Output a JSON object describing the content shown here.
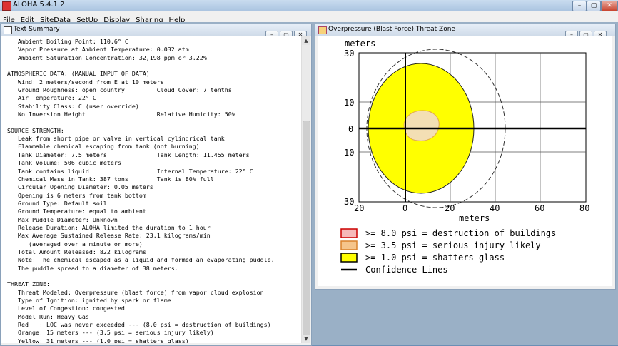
{
  "app": {
    "title": "ALOHA 5.4.1.2"
  },
  "menu": {
    "items": [
      "File",
      "Edit",
      "SiteData",
      "SetUp",
      "Display",
      "Sharing",
      "Help"
    ]
  },
  "text_summary": {
    "title": "Text Summary",
    "lines": [
      "   Ambient Boiling Point: 110.6° C",
      "   Vapor Pressure at Ambient Temperature: 0.032 atm",
      "   Ambient Saturation Concentration: 32,198 ppm or 3.22%",
      "",
      "ATMOSPHERIC DATA: (MANUAL INPUT OF DATA)",
      "   Wind: 2 meters/second from E at 10 meters",
      "   Ground Roughness: open country         Cloud Cover: 7 tenths",
      "   Air Temperature: 22° C",
      "   Stability Class: C (user override)",
      "   No Inversion Height                    Relative Humidity: 50%",
      "",
      "SOURCE STRENGTH:",
      "   Leak from short pipe or valve in vertical cylindrical tank",
      "   Flammable chemical escaping from tank (not burning)",
      "   Tank Diameter: 7.5 meters              Tank Length: 11.455 meters",
      "   Tank Volume: 506 cubic meters",
      "   Tank contains liquid                   Internal Temperature: 22° C",
      "   Chemical Mass in Tank: 387 tons        Tank is 80% full",
      "   Circular Opening Diameter: 0.05 meters",
      "   Opening is 6 meters from tank bottom",
      "   Ground Type: Default soil",
      "   Ground Temperature: equal to ambient",
      "   Max Puddle Diameter: Unknown",
      "   Release Duration: ALOHA limited the duration to 1 hour",
      "   Max Average Sustained Release Rate: 23.1 kilograms/min",
      "      (averaged over a minute or more)",
      "   Total Amount Released: 822 kilograms",
      "   Note: The chemical escaped as a liquid and formed an evaporating puddle.",
      "   The puddle spread to a diameter of 38 meters.",
      "",
      "THREAT ZONE:",
      "   Threat Modeled: Overpressure (blast force) from vapor cloud explosion",
      "   Type of Ignition: ignited by spark or flame",
      "   Level of Congestion: congested",
      "   Model Run: Heavy Gas",
      "   Red   : LOC was never exceeded --- (8.0 psi = destruction of buildings)",
      "   Orange: 15 meters --- (3.5 psi = serious injury likely)",
      "   Yellow: 31 meters --- (1.0 psi = shatters glass)"
    ]
  },
  "threat_zone": {
    "title": "Overpressure (Blast Force) Threat Zone",
    "y_unit": "meters",
    "x_unit": "meters",
    "x_ticks": [
      "20",
      "0",
      "20",
      "40",
      "60",
      "80"
    ],
    "y_ticks": [
      "30",
      "10",
      "0",
      "10",
      "30"
    ],
    "legend": [
      {
        "label": ">= 8.0 psi = destruction of buildings",
        "color": "#e05050"
      },
      {
        "label": ">= 3.5 psi = serious injury likely",
        "color": "#f5a623"
      },
      {
        "label": ">= 1.0 psi = shatters glass",
        "color": "#ffff00"
      },
      {
        "label": "Confidence Lines",
        "color": "#000000"
      }
    ]
  }
}
